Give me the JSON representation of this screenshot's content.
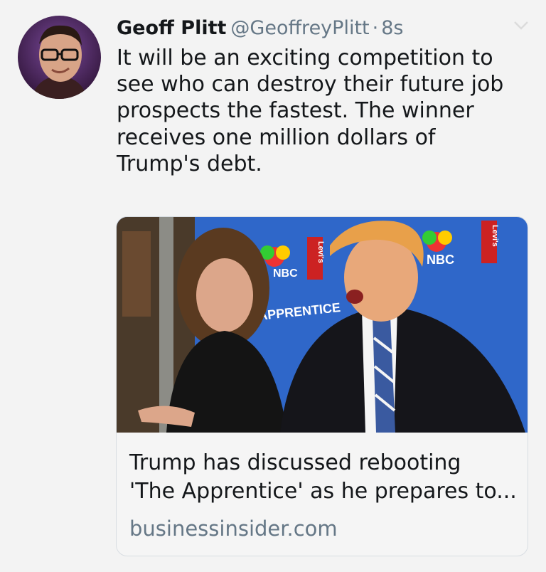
{
  "tweet": {
    "author_name": "Geoff Plitt",
    "author_handle": "@GeoffreyPlitt",
    "separator": "·",
    "timestamp": "8s",
    "text": "It will be an exciting competition to\nsee who can destroy their future job\nprospects the fastest. The winner\nreceives one million dollars of\nTrump's debt."
  },
  "card": {
    "title": "Trump has discussed rebooting\n'The Apprentice' as he prepares to...",
    "domain": "businessinsider.com",
    "image_logos": [
      "NBC",
      "Levi's",
      "APPRENTICE"
    ]
  },
  "colors": {
    "background": "#f3f3f3",
    "secondary_text": "#657786",
    "primary_text": "#14171a",
    "card_border": "#d8dde2",
    "backdrop_blue": "#2f67c9"
  }
}
